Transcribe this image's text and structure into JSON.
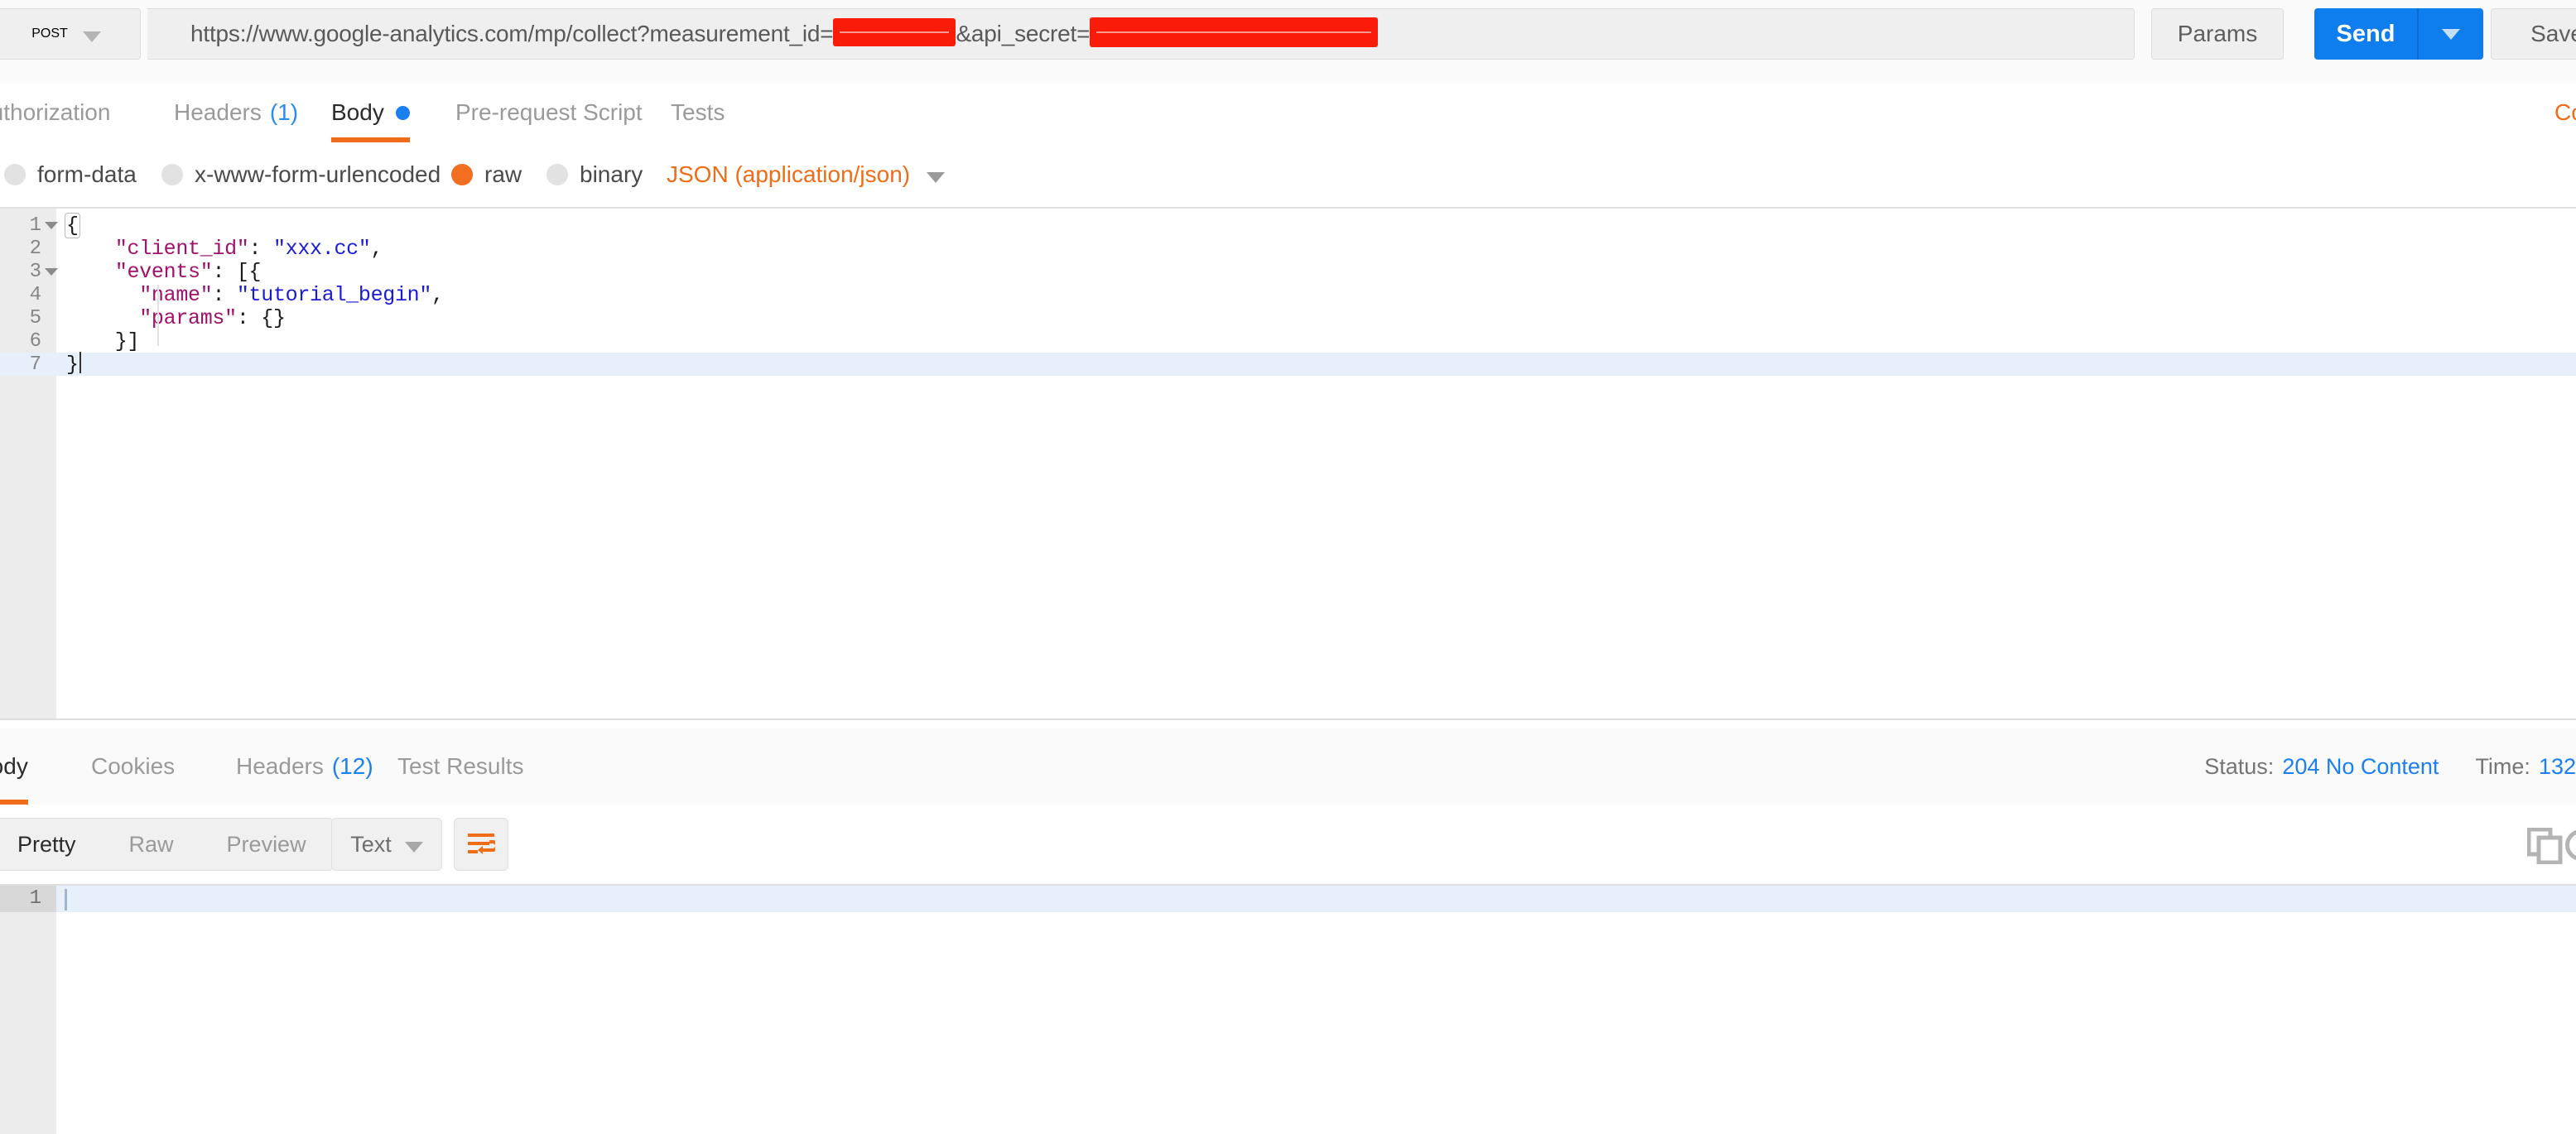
{
  "request": {
    "method": "POST",
    "url_prefix": "https://www.google-analytics.com/mp/collect?measurement_id=",
    "url_middle": "&api_secret=",
    "url_suffix": "",
    "redactions": [
      "measurement_id-value-redacted",
      "api_secret-value-redacted"
    ],
    "params_label": "Params",
    "send_label": "Send",
    "save_label": "Save",
    "tabs": [
      {
        "label": "Authorization",
        "count": "",
        "active": false,
        "dot": false
      },
      {
        "label": "Headers",
        "count": "(1)",
        "active": false,
        "dot": false
      },
      {
        "label": "Body",
        "count": "",
        "active": true,
        "dot": true
      },
      {
        "label": "Pre-request Script",
        "count": "",
        "active": false,
        "dot": false
      },
      {
        "label": "Tests",
        "count": "",
        "active": false,
        "dot": false
      }
    ],
    "code_link": "Code",
    "body_types": [
      {
        "label": "form-data",
        "selected": false
      },
      {
        "label": "x-www-form-urlencoded",
        "selected": false
      },
      {
        "label": "raw",
        "selected": true
      },
      {
        "label": "binary",
        "selected": false
      }
    ],
    "content_type": "JSON (application/json)",
    "editor": {
      "lines": [
        {
          "num": "1",
          "fold": true,
          "indent": 0,
          "html": "{"
        },
        {
          "num": "2",
          "fold": false,
          "indent": 0,
          "html": "    \"client_id\": \"xxx.cc\","
        },
        {
          "num": "3",
          "fold": true,
          "indent": 0,
          "html": "    \"events\": [{"
        },
        {
          "num": "4",
          "fold": false,
          "indent": 1,
          "html": "      \"name\": \"tutorial_begin\","
        },
        {
          "num": "5",
          "fold": false,
          "indent": 1,
          "html": "      \"params\": {}"
        },
        {
          "num": "6",
          "fold": false,
          "indent": 0,
          "html": "    }]"
        },
        {
          "num": "7",
          "fold": false,
          "indent": 0,
          "html": "}"
        }
      ],
      "raw_text": "{\n    \"client_id\": \"xxx.cc\",\n    \"events\": [{\n      \"name\": \"tutorial_begin\",\n      \"params\": {}\n    }]\n}"
    }
  },
  "response": {
    "tabs": [
      {
        "label": "Body",
        "count": "",
        "active": true
      },
      {
        "label": "Cookies",
        "count": "",
        "active": false
      },
      {
        "label": "Headers",
        "count": "(12)",
        "active": false
      },
      {
        "label": "Test Results",
        "count": "",
        "active": false
      }
    ],
    "status_label": "Status:",
    "status_value": "204 No Content",
    "time_label": "Time:",
    "time_value": "132",
    "view_modes": [
      {
        "label": "Pretty",
        "active": true
      },
      {
        "label": "Raw",
        "active": false
      },
      {
        "label": "Preview",
        "active": false
      }
    ],
    "format": "Text",
    "wrap_icon": "word-wrap-icon",
    "copy_icon": "copy-icon",
    "save_response_icon": "save-response-icon",
    "body_lines": [
      {
        "num": "1",
        "text": ""
      }
    ]
  },
  "colors": {
    "accent_orange": "#ef6c19",
    "accent_blue": "#1c7ff0",
    "send_blue": "#0e7ded",
    "redact_red": "#f91d09",
    "muted_gray": "#9a9a9a"
  }
}
